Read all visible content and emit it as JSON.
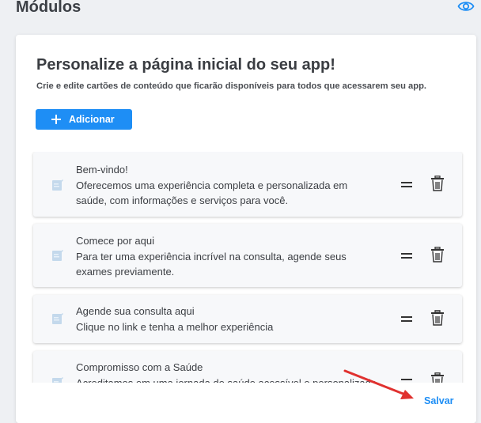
{
  "header": {
    "title": "Módulos",
    "preview_icon": "eye-icon"
  },
  "panel": {
    "title": "Personalize a página inicial do seu app!",
    "subtitle": "Crie e edite cartões de conteúdo que ficarão disponíveis para todos que acessarem seu app.",
    "add_button_label": "Adicionar"
  },
  "cards": [
    {
      "title": "Bem-vindo!",
      "text": "Oferecemos uma experiência completa e personalizada em saúde, com informações e serviços para você."
    },
    {
      "title": "Comece por aqui",
      "text": "Para ter uma experiência incrível na consulta, agende seus exames previamente."
    },
    {
      "title": "Agende sua consulta aqui",
      "text": "Clique no link e tenha a melhor experiência"
    },
    {
      "title": "Compromisso com a Saúde",
      "text": "Acreditamos em uma jornada de saúde acessível e personalizada"
    }
  ],
  "footer": {
    "save_label": "Salvar"
  },
  "colors": {
    "accent": "#1e8ef5",
    "annotation_arrow": "#e0312f"
  }
}
